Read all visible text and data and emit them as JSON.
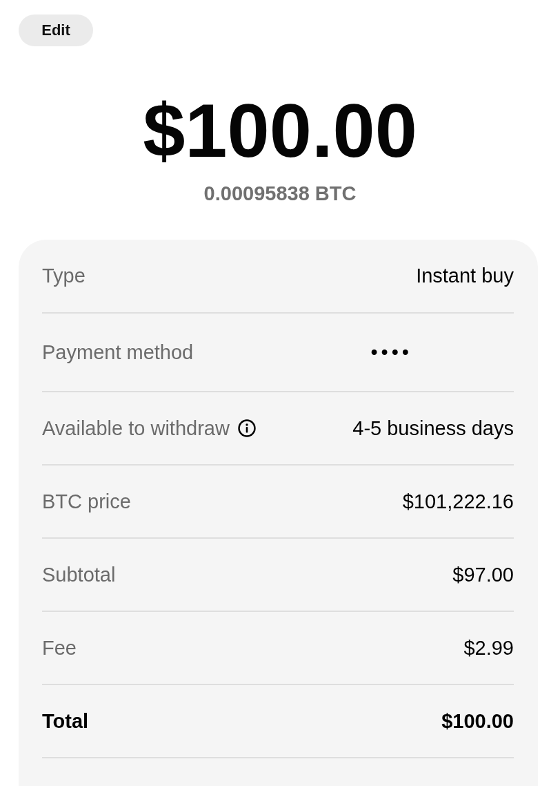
{
  "edit_button": {
    "label": "Edit"
  },
  "amount": {
    "fiat": "$100.00",
    "crypto": "0.00095838 BTC"
  },
  "details": {
    "rows": [
      {
        "kind": "text",
        "label": "Type",
        "value": "Instant buy"
      },
      {
        "kind": "masked",
        "label": "Payment method",
        "value": "••••"
      },
      {
        "kind": "info",
        "label": "Available to withdraw",
        "value": "4-5 business days"
      },
      {
        "kind": "text",
        "label": "BTC price",
        "value": "$101,222.16"
      },
      {
        "kind": "text",
        "label": "Subtotal",
        "value": "$97.00"
      },
      {
        "kind": "text",
        "label": "Fee",
        "value": "$2.99"
      },
      {
        "kind": "total",
        "label": "Total",
        "value": "$100.00"
      }
    ]
  }
}
